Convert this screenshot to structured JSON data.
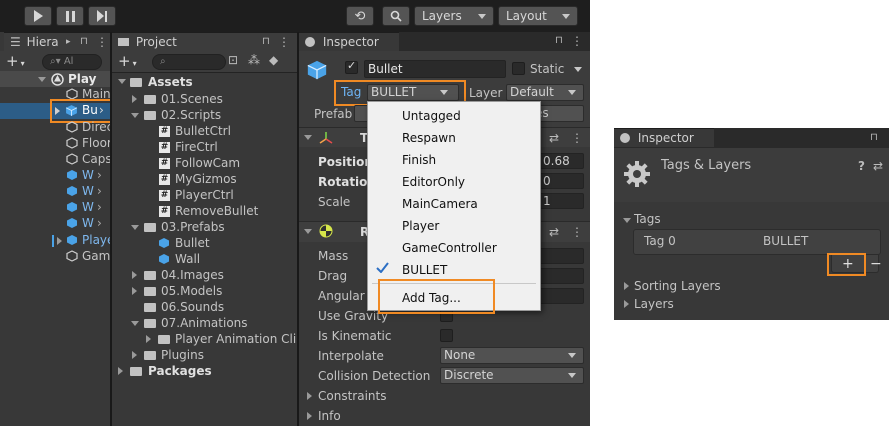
{
  "toolbar": {
    "layers_label": "Layers",
    "layout_label": "Layout"
  },
  "hierarchy": {
    "tab_label": "Hiera",
    "search_placeholder": "Al",
    "items": [
      "Play",
      "Bu",
      "Main",
      "Direc",
      "Floor",
      "Caps",
      "W",
      "W",
      "W",
      "W",
      "Player",
      "Game"
    ]
  },
  "project": {
    "tab_label": "Project",
    "tree": {
      "assets": "Assets",
      "scenes": "01.Scenes",
      "scripts": "02.Scripts",
      "script_files": [
        "BulletCtrl",
        "FireCtrl",
        "FollowCam",
        "MyGizmos",
        "PlayerCtrl",
        "RemoveBullet"
      ],
      "prefabs": "03.Prefabs",
      "prefab_files": [
        "Bullet",
        "Wall"
      ],
      "images": "04.Images",
      "models": "05.Models",
      "sounds": "06.Sounds",
      "animations": "07.Animations",
      "anim_clip": "Player Animation Clip",
      "plugins": "Plugins",
      "packages": "Packages"
    }
  },
  "inspector": {
    "tab_label": "Inspector",
    "object_name": "Bullet",
    "static_label": "Static",
    "tag_label": "Tag",
    "tag_value": "BULLET",
    "layer_label": "Layer",
    "layer_value": "Default",
    "prefab_label": "Prefab",
    "prefab_overrides_tail": "es",
    "transform_header_letter": "T",
    "position_label": "Position",
    "position_tail": "0.68",
    "rotation_label": "Rotation",
    "rotation_tail": "0",
    "scale_label": "Scale",
    "scale_tail": "1",
    "rigidbody_header_letter": "R",
    "mass_label": "Mass",
    "drag_label": "Drag",
    "angular_drag_label": "Angular D",
    "use_gravity_label": "Use Gravity",
    "is_kinematic_label": "Is Kinematic",
    "interpolate_label": "Interpolate",
    "interpolate_value": "None",
    "collision_label": "Collision Detection",
    "collision_value": "Discrete",
    "constraints_label": "Constraints",
    "info_label": "Info"
  },
  "tag_menu": {
    "items": [
      "Untagged",
      "Respawn",
      "Finish",
      "EditorOnly",
      "MainCamera",
      "Player",
      "GameController",
      "BULLET"
    ],
    "selected": "BULLET",
    "add_label": "Add Tag..."
  },
  "tags_layers": {
    "tab_label": "Inspector",
    "title": "Tags & Layers",
    "tags_section": "Tags",
    "tag0_label": "Tag 0",
    "tag0_value": "BULLET",
    "sorting_layers": "Sorting Layers",
    "layers": "Layers",
    "plus_label": "+",
    "minus_label": "−"
  },
  "colors": {
    "highlight": "#f08a24",
    "selection": "#2c5d87",
    "accent_blue": "#4aa3e8"
  }
}
